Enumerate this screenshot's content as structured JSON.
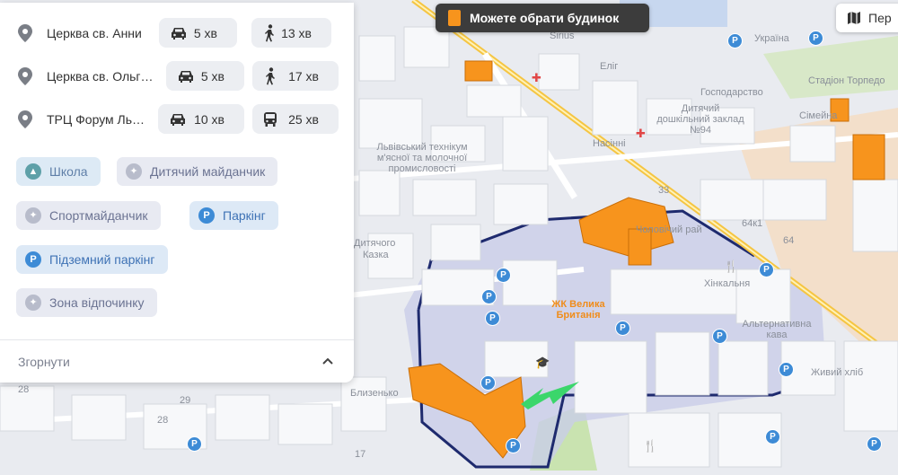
{
  "toast": {
    "label": "Можете обрати будинок"
  },
  "map_button": {
    "label": "Пер"
  },
  "routes": [
    {
      "name": "Церква св. Анни",
      "car": "5 хв",
      "second": "13 хв",
      "second_mode": "walk"
    },
    {
      "name": "Церква св. Ольг…",
      "car": "5 хв",
      "second": "17 хв",
      "second_mode": "walk"
    },
    {
      "name": "ТРЦ Форум Ль…",
      "car": "10 хв",
      "second": "25 хв",
      "second_mode": "bus"
    }
  ],
  "tags": [
    {
      "label": "Школа",
      "icon": "school-icon"
    },
    {
      "label": "Дитячий майданчик",
      "icon": "playground-icon"
    },
    {
      "label": "Спортмайданчик",
      "icon": "sport-icon"
    },
    {
      "label": "Паркінг",
      "icon": "parking-icon"
    },
    {
      "label": "Підземний паркінг",
      "icon": "parking-icon"
    },
    {
      "label": "Зона відпочинку",
      "icon": "recreation-icon"
    }
  ],
  "collapse": {
    "label": "Згорнути"
  },
  "map": {
    "complex_label": "ЖК Велика Британія",
    "labels": {
      "a": "Хінкальня",
      "b": "Альтернативна кава",
      "c": "Живий хліб",
      "d": "Близенько",
      "e": "Чоловічий рай",
      "f": "Львівський технікум м'ясної та молочної промисловості",
      "g": "Дитячий дошкільний заклад №94",
      "h": "Насінні",
      "i": "Стадіон Торпедо",
      "j": "Сімейна",
      "k": "Господарство",
      "l": "Еліг",
      "m": "Sirius",
      "n": "Україна",
      "o": "Казка",
      "p": "Дитячого"
    },
    "numbers": [
      "64",
      "28",
      "33",
      "17",
      "28",
      "29",
      "64к1"
    ],
    "colors": {
      "highlight": "#f7941d",
      "road": "#f5c542",
      "boundary": "#1e2a6e",
      "parking": "#3d8bd6"
    }
  }
}
